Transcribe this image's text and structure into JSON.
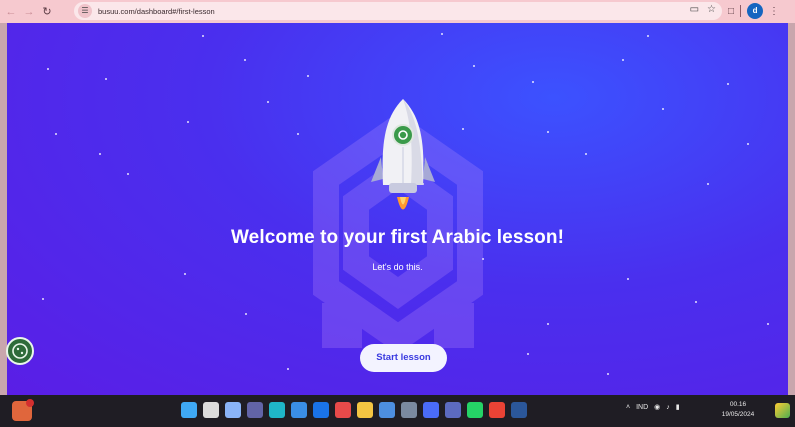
{
  "browser": {
    "url": "busuu.com/dashboard#/first-lesson",
    "nav": [
      "back-icon",
      "forward-icon",
      "reload-icon"
    ],
    "profile_initial": "d"
  },
  "main": {
    "title": "Welcome to your first Arabic lesson!",
    "subtitle": "Let's do this.",
    "start_button": "Start lesson"
  },
  "taskbar": {
    "language": "IND",
    "time": "00.16",
    "date": "19/05/2024",
    "notification_badge": "1"
  },
  "colors": {
    "background_top": "#3c52ff",
    "background_bottom": "#5a1ee6",
    "button_text": "#3a3ae0",
    "chrome": "#f6c9cf"
  }
}
